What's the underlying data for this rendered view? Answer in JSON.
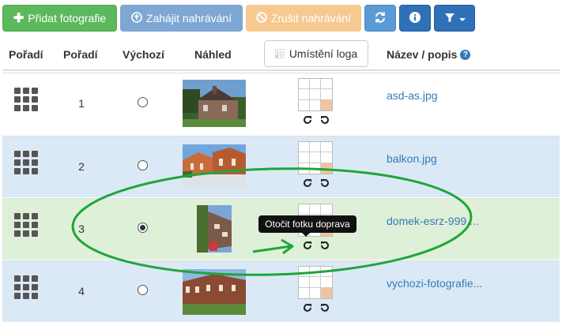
{
  "toolbar": {
    "add_photo": "Přidat fotografie",
    "start_upload": "Zahájit nahrávání",
    "cancel_upload": "Zrušit nahrávání",
    "colors": {
      "success": "#5cb85c",
      "primary": "#2f71b8",
      "warning_faded": "#f6c991",
      "primary_faded": "#7ea7d4"
    }
  },
  "table": {
    "headers": {
      "order1": "Pořadí",
      "order2": "Pořadí",
      "default": "Výchozí",
      "preview": "Náhled",
      "logo_position": "Umístění loga",
      "name": "Název / popis"
    },
    "rows": [
      {
        "order": "1",
        "default": false,
        "name": "asd-as.jpg",
        "logo_cell": 9,
        "style": "white",
        "icon": "grid-handle-icon"
      },
      {
        "order": "2",
        "default": false,
        "name": "balkon.jpg",
        "logo_cell": 9,
        "style": "blue",
        "icon": "grid-handle-icon"
      },
      {
        "order": "3",
        "default": true,
        "name": "domek-esrz-999....",
        "logo_cell": 9,
        "style": "green",
        "icon": "grid-handle-icon"
      },
      {
        "order": "4",
        "default": false,
        "name": "vychozi-fotografie...",
        "logo_cell": 9,
        "style": "blue",
        "icon": "grid-handle-icon"
      }
    ]
  },
  "tooltip": {
    "text": "Otočit fotku doprava"
  },
  "annotation": {
    "color": "#1fa53a",
    "shape": "ellipse-with-arrow"
  },
  "icons": [
    "plus-icon",
    "upload-icon",
    "ban-icon",
    "refresh-icon",
    "info-icon",
    "filter-icon",
    "caret-down-icon",
    "question-icon",
    "rotate-right-icon",
    "rotate-left-icon"
  ]
}
